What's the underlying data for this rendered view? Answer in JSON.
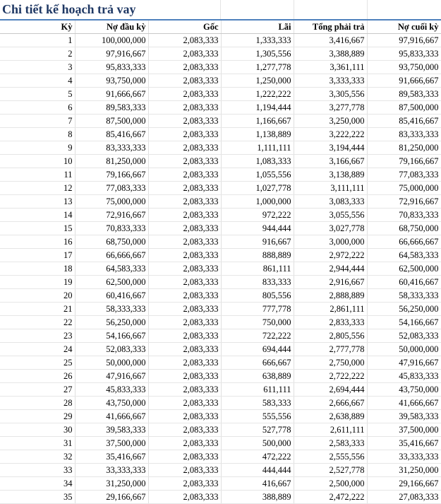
{
  "title": "Chi tiết kế hoạch trả vay",
  "headers": [
    "Kỳ",
    "Nợ đầu kỳ",
    "Gốc",
    "Lãi",
    "Tổng phải trả",
    "Nợ cuối kỳ"
  ],
  "rows": [
    [
      "1",
      "100,000,000",
      "2,083,333",
      "1,333,333",
      "3,416,667",
      "97,916,667"
    ],
    [
      "2",
      "97,916,667",
      "2,083,333",
      "1,305,556",
      "3,388,889",
      "95,833,333"
    ],
    [
      "3",
      "95,833,333",
      "2,083,333",
      "1,277,778",
      "3,361,111",
      "93,750,000"
    ],
    [
      "4",
      "93,750,000",
      "2,083,333",
      "1,250,000",
      "3,333,333",
      "91,666,667"
    ],
    [
      "5",
      "91,666,667",
      "2,083,333",
      "1,222,222",
      "3,305,556",
      "89,583,333"
    ],
    [
      "6",
      "89,583,333",
      "2,083,333",
      "1,194,444",
      "3,277,778",
      "87,500,000"
    ],
    [
      "7",
      "87,500,000",
      "2,083,333",
      "1,166,667",
      "3,250,000",
      "85,416,667"
    ],
    [
      "8",
      "85,416,667",
      "2,083,333",
      "1,138,889",
      "3,222,222",
      "83,333,333"
    ],
    [
      "9",
      "83,333,333",
      "2,083,333",
      "1,111,111",
      "3,194,444",
      "81,250,000"
    ],
    [
      "10",
      "81,250,000",
      "2,083,333",
      "1,083,333",
      "3,166,667",
      "79,166,667"
    ],
    [
      "11",
      "79,166,667",
      "2,083,333",
      "1,055,556",
      "3,138,889",
      "77,083,333"
    ],
    [
      "12",
      "77,083,333",
      "2,083,333",
      "1,027,778",
      "3,111,111",
      "75,000,000"
    ],
    [
      "13",
      "75,000,000",
      "2,083,333",
      "1,000,000",
      "3,083,333",
      "72,916,667"
    ],
    [
      "14",
      "72,916,667",
      "2,083,333",
      "972,222",
      "3,055,556",
      "70,833,333"
    ],
    [
      "15",
      "70,833,333",
      "2,083,333",
      "944,444",
      "3,027,778",
      "68,750,000"
    ],
    [
      "16",
      "68,750,000",
      "2,083,333",
      "916,667",
      "3,000,000",
      "66,666,667"
    ],
    [
      "17",
      "66,666,667",
      "2,083,333",
      "888,889",
      "2,972,222",
      "64,583,333"
    ],
    [
      "18",
      "64,583,333",
      "2,083,333",
      "861,111",
      "2,944,444",
      "62,500,000"
    ],
    [
      "19",
      "62,500,000",
      "2,083,333",
      "833,333",
      "2,916,667",
      "60,416,667"
    ],
    [
      "20",
      "60,416,667",
      "2,083,333",
      "805,556",
      "2,888,889",
      "58,333,333"
    ],
    [
      "21",
      "58,333,333",
      "2,083,333",
      "777,778",
      "2,861,111",
      "56,250,000"
    ],
    [
      "22",
      "56,250,000",
      "2,083,333",
      "750,000",
      "2,833,333",
      "54,166,667"
    ],
    [
      "23",
      "54,166,667",
      "2,083,333",
      "722,222",
      "2,805,556",
      "52,083,333"
    ],
    [
      "24",
      "52,083,333",
      "2,083,333",
      "694,444",
      "2,777,778",
      "50,000,000"
    ],
    [
      "25",
      "50,000,000",
      "2,083,333",
      "666,667",
      "2,750,000",
      "47,916,667"
    ],
    [
      "26",
      "47,916,667",
      "2,083,333",
      "638,889",
      "2,722,222",
      "45,833,333"
    ],
    [
      "27",
      "45,833,333",
      "2,083,333",
      "611,111",
      "2,694,444",
      "43,750,000"
    ],
    [
      "28",
      "43,750,000",
      "2,083,333",
      "583,333",
      "2,666,667",
      "41,666,667"
    ],
    [
      "29",
      "41,666,667",
      "2,083,333",
      "555,556",
      "2,638,889",
      "39,583,333"
    ],
    [
      "30",
      "39,583,333",
      "2,083,333",
      "527,778",
      "2,611,111",
      "37,500,000"
    ],
    [
      "31",
      "37,500,000",
      "2,083,333",
      "500,000",
      "2,583,333",
      "35,416,667"
    ],
    [
      "32",
      "35,416,667",
      "2,083,333",
      "472,222",
      "2,555,556",
      "33,333,333"
    ],
    [
      "33",
      "33,333,333",
      "2,083,333",
      "444,444",
      "2,527,778",
      "31,250,000"
    ],
    [
      "34",
      "31,250,000",
      "2,083,333",
      "416,667",
      "2,500,000",
      "29,166,667"
    ],
    [
      "35",
      "29,166,667",
      "2,083,333",
      "388,889",
      "2,472,222",
      "27,083,333"
    ]
  ],
  "colors": {
    "title": "#1f3864",
    "title_underline": "#4f81bd",
    "gridline": "#e0e0e0"
  }
}
